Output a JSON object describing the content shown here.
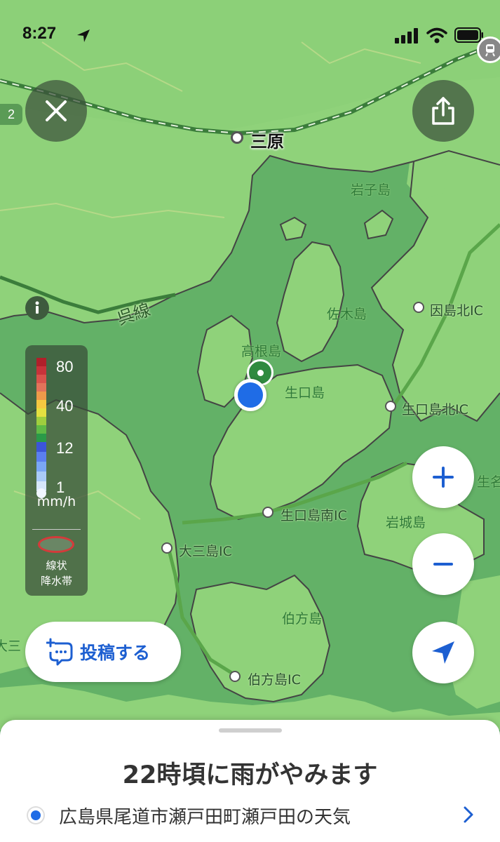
{
  "status_bar": {
    "time": "8:27"
  },
  "map": {
    "city_label": "三原",
    "rail_line_label": "呉線",
    "islands": [
      "岩子島",
      "佐木島",
      "高根島",
      "生口島",
      "岩城島",
      "伯方島"
    ],
    "interchanges": [
      "因島北IC",
      "生口島北IC",
      "生口島南IC",
      "大三島IC",
      "伯方島IC"
    ],
    "edge_labels": [
      "大三",
      "生名"
    ],
    "route_shield": "2"
  },
  "legend": {
    "values": [
      "80",
      "40",
      "12",
      "1"
    ],
    "unit": "mm/h",
    "band_label_line1": "線状",
    "band_label_line2": "降水帯"
  },
  "buttons": {
    "post_label": "投稿する"
  },
  "sheet": {
    "headline": "22時頃に雨がやみます",
    "location": "広島県尾道市瀬戸田町瀬戸田の天気"
  },
  "colors": {
    "sea": "#63b167",
    "land": "#8fd27a",
    "accent_blue": "#1f6ce6",
    "post_blue": "#1d5fd1"
  }
}
